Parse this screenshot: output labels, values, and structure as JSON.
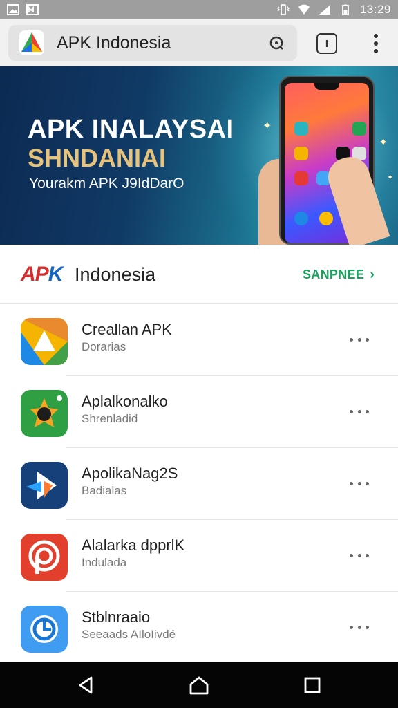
{
  "status_bar": {
    "time": "13:29",
    "left_icons": [
      "image-icon",
      "gallery-icon"
    ],
    "right_icons": [
      "vibrate-icon",
      "wifi-icon",
      "signal-icon",
      "battery-icon"
    ]
  },
  "browser": {
    "title": "APK Indonesia",
    "url_action_icon": "search-icon",
    "tabs_icon_label": "I",
    "menu_icon": "more-vert-icon"
  },
  "banner": {
    "title": "APK INALAYSAI",
    "subtitle": "SHNDANIAI",
    "tagline": "Yourakm APK J9IdDarO"
  },
  "section": {
    "brand_mark_a": "AP",
    "brand_mark_k": "K",
    "brand_name": "Indonesia",
    "see_all_label": "SANPNEE",
    "see_all_chevron": "›"
  },
  "apps": [
    {
      "name": "Creallan APK",
      "subtitle": "Dorarias",
      "icon": "triangle-app-icon"
    },
    {
      "name": "Aplalkonalko",
      "subtitle": "Shrenladid",
      "icon": "star-app-icon"
    },
    {
      "name": "ApolikaNag2S",
      "subtitle": "Badialas",
      "icon": "play-app-icon"
    },
    {
      "name": "Alalarka dpprlK",
      "subtitle": "Indulada",
      "icon": "p-app-icon"
    },
    {
      "name": "Stblnraaio",
      "subtitle": "Seeaads AIloIivdé",
      "icon": "clock-app-icon"
    }
  ],
  "colors": {
    "accent_green": "#1aa35f",
    "brand_red": "#d32f2f",
    "brand_blue": "#1565c0",
    "banner_gold": "#e6c27a"
  },
  "nav": {
    "back_icon": "back-icon",
    "home_icon": "home-icon",
    "recents_icon": "recents-icon"
  }
}
